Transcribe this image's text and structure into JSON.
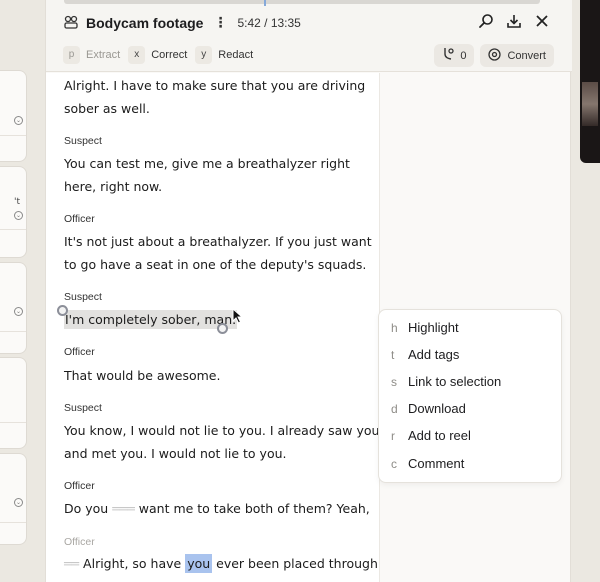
{
  "header": {
    "title": "Bodycam footage",
    "timecode": "5:42 / 13:35",
    "progress_fraction": 0.42
  },
  "actions": [
    {
      "key": "p",
      "label": "Extract",
      "dim": true
    },
    {
      "key": "x",
      "label": "Correct",
      "dim": false
    },
    {
      "key": "y",
      "label": "Redact",
      "dim": false
    }
  ],
  "toolbar": {
    "count": "0",
    "convert_label": "Convert"
  },
  "left_fragments": [
    "t",
    "'t"
  ],
  "transcript": {
    "top_text_1": "Alright. I have to make sure that you are driving",
    "top_text_2": "sober as well.",
    "b1_speaker": "Suspect",
    "b1_line1": "You can test me, give me a breathalyzer right",
    "b1_line2": "here, right now.",
    "b2_speaker": "Officer",
    "b2_line1": "It's not just about a breathalyzer. If you just want",
    "b2_line2": "to go have a seat in one of the deputy's squads.",
    "b3_speaker": "Suspect",
    "b3_line1": "I'm completely sober, man.",
    "b4_speaker": "Officer",
    "b4_line1": "That would be awesome.",
    "b5_speaker": "Suspect",
    "b5_line1": "You know, I would not lie to you. I already saw you",
    "b5_line2": "and met you. I would not lie to you.",
    "b6_speaker": "Officer",
    "b6_line1_a": "Do you",
    "b6_line1_b": "want me to take both of them? Yeah,",
    "b7_speaker": "Officer",
    "b7_line1_a": "Alright, so have",
    "b7_line1_hl": "you",
    "b7_line1_b": "ever been placed through"
  },
  "menu": [
    {
      "key": "h",
      "label": "Highlight"
    },
    {
      "key": "t",
      "label": "Add tags"
    },
    {
      "key": "s",
      "label": "Link to selection"
    },
    {
      "key": "d",
      "label": "Download"
    },
    {
      "key": "r",
      "label": "Add to reel"
    },
    {
      "key": "c",
      "label": "Comment"
    }
  ],
  "colors": {
    "highlight": "#a9c3ee",
    "selection": "#e2e1df",
    "background": "#ebe8e1"
  }
}
